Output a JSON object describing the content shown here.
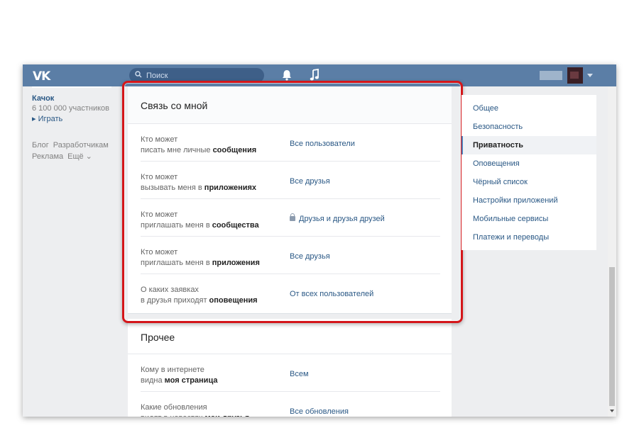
{
  "topbar": {
    "logo": "VK",
    "search_placeholder": "Поиск",
    "search_icon": "search-icon",
    "notifications_icon": "bell-icon",
    "music_icon": "music-note-icon"
  },
  "left": {
    "game_title": "Качок",
    "game_members": "6 100 000 участников",
    "game_play": "▸ Играть",
    "footer": [
      "Блог",
      "Разработчикам",
      "Реклама",
      "Ещё ⌄"
    ]
  },
  "contact_section": {
    "title": "Связь со мной",
    "rows": [
      {
        "label_pre": "Кто может",
        "label_mid": "писать мне личные ",
        "label_bold": "сообщения",
        "value": "Все пользователи",
        "locked": false
      },
      {
        "label_pre": "Кто может",
        "label_mid": "вызывать меня в ",
        "label_bold": "приложениях",
        "value": "Все друзья",
        "locked": false
      },
      {
        "label_pre": "Кто может",
        "label_mid": "приглашать меня в ",
        "label_bold": "сообщества",
        "value": "Друзья и друзья друзей",
        "locked": true
      },
      {
        "label_pre": "Кто может",
        "label_mid": "приглашать меня в ",
        "label_bold": "приложения",
        "value": "Все друзья",
        "locked": false
      },
      {
        "label_pre": "О каких заявках",
        "label_mid": "в друзья приходят ",
        "label_bold": "оповещения",
        "value": "От всех пользователей",
        "locked": false
      }
    ]
  },
  "other_section": {
    "title": "Прочее",
    "rows": [
      {
        "label_pre": "Кому в интернете",
        "label_mid": "видна ",
        "label_bold": "моя страница",
        "value": "Всем"
      },
      {
        "label_pre": "Какие обновления",
        "label_mid": "видят в новостях ",
        "label_bold": "мои друзья",
        "value": "Все обновления"
      }
    ]
  },
  "settings_menu": {
    "items": [
      {
        "label": "Общее",
        "active": false
      },
      {
        "label": "Безопасность",
        "active": false
      },
      {
        "label": "Приватность",
        "active": true
      },
      {
        "label": "Оповещения",
        "active": false
      },
      {
        "label": "Чёрный список",
        "active": false
      },
      {
        "label": "Настройки приложений",
        "active": false
      },
      {
        "label": "Мобильные сервисы",
        "active": false
      },
      {
        "label": "Платежи и переводы",
        "active": false
      }
    ]
  },
  "colors": {
    "header": "#5b7ea6",
    "link": "#2a5885",
    "highlight": "#d4161a",
    "background": "#edeef0"
  }
}
